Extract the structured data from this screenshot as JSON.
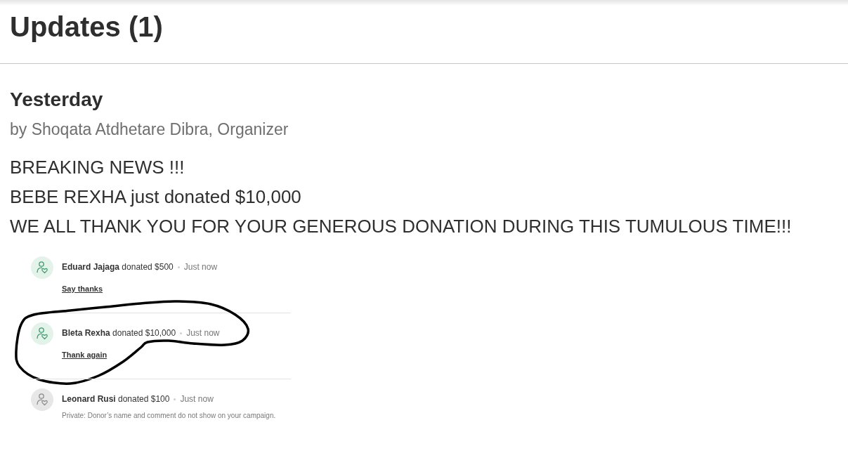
{
  "section": {
    "title": "Updates (1)"
  },
  "update": {
    "date": "Yesterday",
    "byline": "by Shoqata Atdhetare Dibra, Organizer",
    "body": [
      "BREAKING NEWS !!!",
      "BEBE REXHA just donated $10,000",
      "WE ALL THANK YOU FOR YOUR GENEROUS DONATION DURING THIS TUMULOUS TIME!!!"
    ],
    "screenshot": {
      "donations": [
        {
          "text": "**Eduard Jajaga** donated $500",
          "time": "Just now",
          "link": "Say thanks",
          "private": false,
          "circled": false
        },
        {
          "text": "**Bleta Rexha** donated $10,000",
          "time": "Just now",
          "link": "Thank again",
          "private": false,
          "circled": true
        },
        {
          "text": "**Leonard Rusi** donated $100",
          "time": "Just now",
          "note": "Private: Donor’s name and comment do not show on your campaign.",
          "private": true,
          "circled": false
        }
      ]
    }
  }
}
